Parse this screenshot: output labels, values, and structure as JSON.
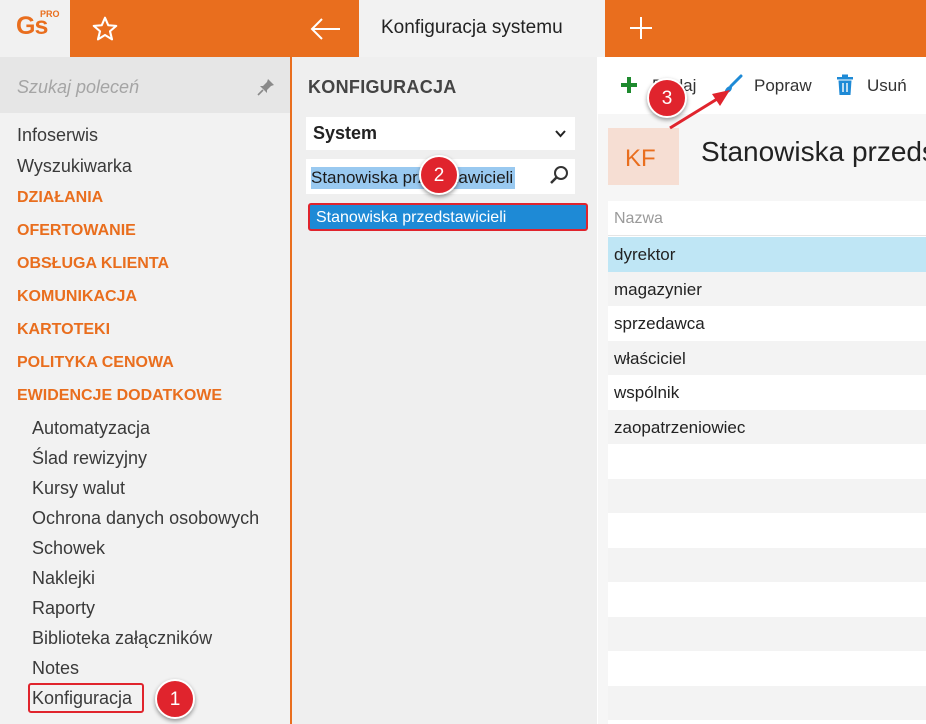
{
  "app": {
    "logo": "Gs",
    "logo_badge": "PRO",
    "active_tab": "Konfiguracja systemu"
  },
  "sidebar": {
    "search_placeholder": "Szukaj poleceń",
    "items": [
      "Infoserwis",
      "Wyszukiwarka"
    ],
    "sections": [
      "DZIAŁANIA",
      "OFERTOWANIE",
      "OBSŁUGA KLIENTA",
      "KOMUNIKACJA",
      "KARTOTEKI",
      "POLITYKA CENOWA",
      "EWIDENCJE DODATKOWE"
    ],
    "sub_items": [
      "Automatyzacja",
      "Ślad rewizyjny",
      "Kursy walut",
      "Ochrona danych osobowych",
      "Schowek",
      "Naklejki",
      "Raporty",
      "Biblioteka załączników",
      "Notes",
      "Konfiguracja"
    ]
  },
  "middle": {
    "title": "KONFIGURACJA",
    "category_select": "System",
    "filter_value": "Stanowiska przedstawicieli",
    "result_item": "Stanowiska przedstawicieli"
  },
  "toolbar": {
    "add_label": "Dodaj",
    "edit_label": "Popraw",
    "delete_label": "Usuń"
  },
  "content": {
    "badge": "KF",
    "title": "Stanowiska przedstawicieli",
    "column_header": "Nazwa",
    "rows": [
      "dyrektor",
      "magazynier",
      "sprzedawca",
      "właściciel",
      "wspólnik",
      "zaopatrzeniowiec"
    ]
  },
  "annotations": [
    "1",
    "2",
    "3"
  ],
  "colors": {
    "accent": "#e96e1e",
    "selection": "#1e8ad6",
    "callout": "#e0242d",
    "row_highlight": "#bfe6f5"
  }
}
